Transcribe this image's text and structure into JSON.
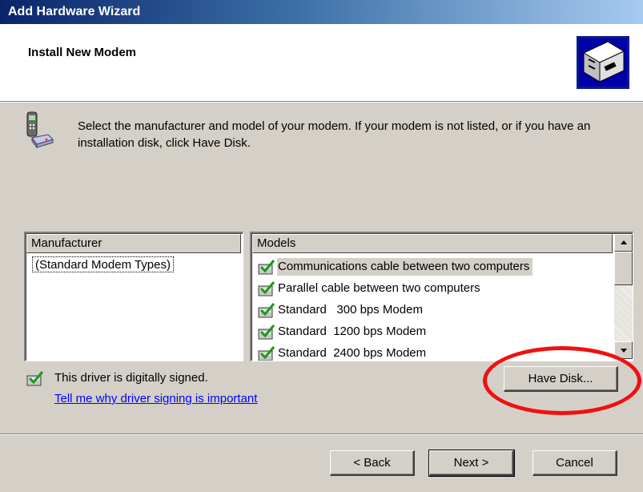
{
  "window": {
    "title": "Add Hardware Wizard"
  },
  "header": {
    "title": "Install New Modem",
    "icon": "hardware-wizard-icon"
  },
  "instructions": {
    "text": "Select the manufacturer and model of your modem. If your modem is not listed, or if you have an installation disk, click Have Disk.",
    "icon": "phone-modem-icon"
  },
  "manufacturer_list": {
    "header": "Manufacturer",
    "items": [
      "(Standard Modem Types)"
    ],
    "selected_index": 0
  },
  "models_list": {
    "header": "Models",
    "items": [
      "Communications cable between two computers",
      "Parallel cable between two computers",
      "Standard   300 bps Modem",
      "Standard  1200 bps Modem",
      "Standard  2400 bps Modem"
    ],
    "selected_index": 0,
    "item_icon": "signed-driver-icon"
  },
  "signing": {
    "text": "This driver is digitally signed.",
    "link": "Tell me why driver signing is important",
    "icon": "signed-driver-icon"
  },
  "buttons": {
    "have_disk": "Have Disk...",
    "back": "< Back",
    "next": "Next >",
    "cancel": "Cancel"
  },
  "colors": {
    "title_bar_start": "#0a246a",
    "title_bar_end": "#a6caf0",
    "dialog_bg": "#d4d0c8",
    "link": "#0000ff",
    "annotation_ring": "#ee1111"
  }
}
